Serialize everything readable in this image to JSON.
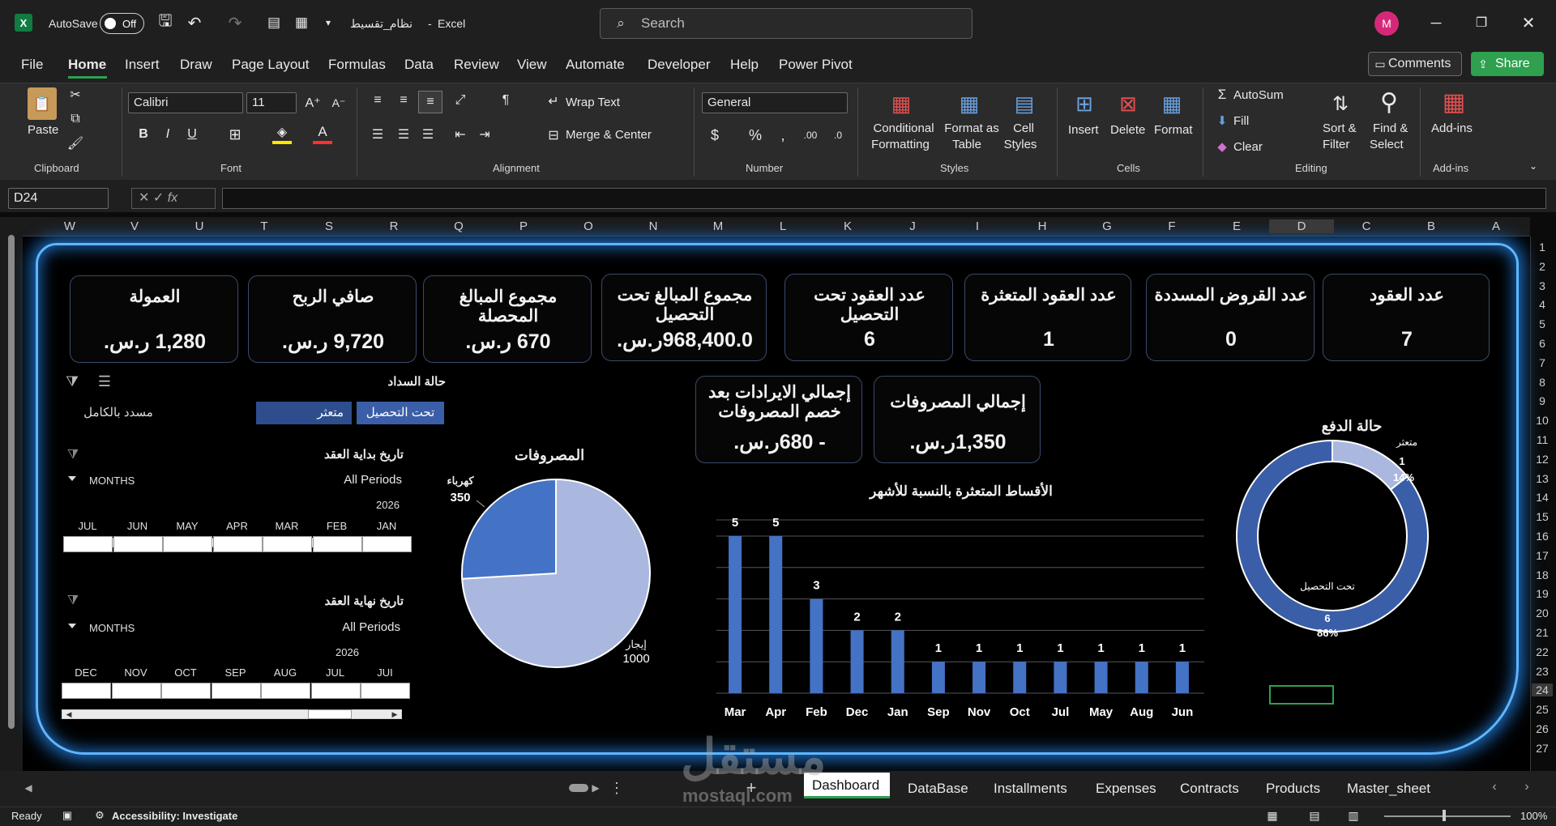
{
  "app": {
    "autosave": "AutoSave",
    "autosave_state": "Off",
    "filename": "نظام_تقسيط",
    "app_name": "Excel",
    "search_placeholder": "Search",
    "avatar": "M"
  },
  "menu": [
    "File",
    "Home",
    "Insert",
    "Draw",
    "Page Layout",
    "Formulas",
    "Data",
    "Review",
    "View",
    "Automate",
    "Developer",
    "Help",
    "Power Pivot"
  ],
  "actions": {
    "comments": "Comments",
    "share": "Share"
  },
  "ribbon": {
    "clipboard": {
      "paste": "Paste",
      "group": "Clipboard"
    },
    "font": {
      "name": "Calibri",
      "size": "11",
      "group": "Font"
    },
    "alignment": {
      "wrap": "Wrap Text",
      "merge": "Merge & Center",
      "group": "Alignment"
    },
    "number": {
      "format": "General",
      "group": "Number"
    },
    "styles": {
      "cond1": "Conditional",
      "cond2": "Formatting",
      "fmt1": "Format as",
      "fmt2": "Table",
      "cell1": "Cell",
      "cell2": "Styles",
      "group": "Styles"
    },
    "cells": {
      "insert": "Insert",
      "delete": "Delete",
      "format": "Format",
      "group": "Cells"
    },
    "editing": {
      "autosum": "AutoSum",
      "fill": "Fill",
      "clear": "Clear",
      "sort1": "Sort &",
      "sort2": "Filter",
      "find1": "Find &",
      "find2": "Select",
      "group": "Editing"
    },
    "addins": {
      "label": "Add-ins",
      "group": "Add-ins"
    }
  },
  "formula": {
    "namebox": "D24",
    "fx": "fx"
  },
  "columns": [
    "W",
    "V",
    "U",
    "T",
    "S",
    "R",
    "Q",
    "P",
    "O",
    "N",
    "M",
    "L",
    "K",
    "J",
    "I",
    "H",
    "G",
    "F",
    "E",
    "D",
    "C",
    "B",
    "A"
  ],
  "rows": [
    "1",
    "2",
    "3",
    "4",
    "5",
    "6",
    "7",
    "8",
    "9",
    "10",
    "11",
    "12",
    "13",
    "14",
    "15",
    "16",
    "17",
    "18",
    "19",
    "20",
    "21",
    "22",
    "23",
    "24",
    "25",
    "26",
    "27"
  ],
  "kpis": [
    {
      "title": "عدد العقود",
      "value": "7"
    },
    {
      "title": "عدد القروض المسددة",
      "value": "0"
    },
    {
      "title": "عدد العقود المتعثرة",
      "value": "1"
    },
    {
      "title": "عدد العقود تحت التحصيل",
      "value": "6"
    },
    {
      "title": "مجموع المبالغ تحت التحصيل",
      "value": "968,400.0ر.س."
    },
    {
      "title": "مجموع المبالغ المحصلة",
      "value": "670 ر.س."
    },
    {
      "title": "صافي الربح",
      "value": "9,720 ر.س."
    },
    {
      "title": "العمولة",
      "value": "1,280 ر.س."
    }
  ],
  "kpis2": [
    {
      "title": "إجمالي المصروفات",
      "value": "1,350ر.س."
    },
    {
      "title": "إجمالي الايرادات بعد خصم المصروفات",
      "value": "- 680ر.س."
    }
  ],
  "slicer": {
    "title": "حالة السداد",
    "items": [
      "تحت التحصيل",
      "متعثر",
      "مسدد بالكامل"
    ]
  },
  "timeline1": {
    "title": "تاريخ بداية العقد",
    "months_label": "MONTHS",
    "periods": "All Periods",
    "year": "2026",
    "months": [
      "JUL",
      "JUN",
      "MAY",
      "APR",
      "MAR",
      "FEB",
      "JAN"
    ]
  },
  "timeline2": {
    "title": "تاريخ نهاية العقد",
    "months_label": "MONTHS",
    "periods": "All Periods",
    "year": "2026",
    "months": [
      "DEC",
      "NOV",
      "OCT",
      "SEP",
      "AUG",
      "JUL",
      "JUI"
    ]
  },
  "chart_data": [
    {
      "type": "pie",
      "title": "المصروفات",
      "categories": [
        "إيجار",
        "كهرباء"
      ],
      "values": [
        1000,
        350
      ],
      "colors": [
        "#aab8e0",
        "#4472c4"
      ]
    },
    {
      "type": "bar",
      "title": "الأقساط المتعثرة بالنسبة للأشهر",
      "categories": [
        "Mar",
        "Apr",
        "Feb",
        "Dec",
        "Jan",
        "Sep",
        "Nov",
        "Oct",
        "Jul",
        "May",
        "Aug",
        "Jun"
      ],
      "values": [
        5,
        5,
        3,
        2,
        2,
        1,
        1,
        1,
        1,
        1,
        1,
        1
      ],
      "ylim": [
        0,
        5
      ],
      "color": "#4472c4"
    },
    {
      "type": "pie",
      "title": "حالة الدفع",
      "categories": [
        "متعثر",
        "تحت التحصيل"
      ],
      "values": [
        1,
        6
      ],
      "percents": [
        "14%",
        "86%"
      ],
      "colors": [
        "#aab8e0",
        "#3b5ea8"
      ]
    }
  ],
  "tabs": [
    "Dashboard",
    "DataBase",
    "Installments",
    "Expenses",
    "Contracts",
    "Products",
    "Master_sheet"
  ],
  "status": {
    "ready": "Ready",
    "access": "Accessibility: Investigate",
    "zoom": "100%"
  },
  "watermark": {
    "ar": "مستقل",
    "en": "mostaql.com"
  }
}
